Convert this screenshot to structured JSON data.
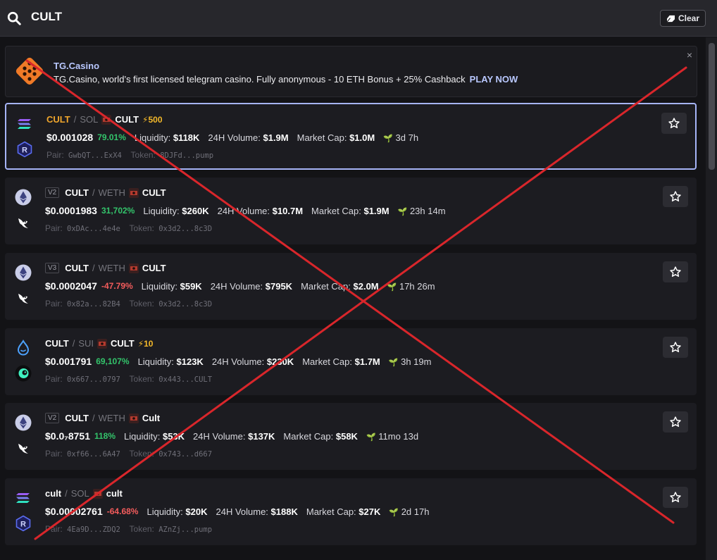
{
  "search": {
    "value": "CULT",
    "clear_label": "Clear"
  },
  "ad": {
    "title": "TG.Casino",
    "text": "TG.Casino, world’s first licensed telegram casino. Fully anonymous - 10 ETH Bonus + 25% Cashback",
    "cta": "PLAY NOW",
    "close": "×"
  },
  "results": [
    {
      "chain": "solana",
      "dex": "raydium",
      "version": "",
      "base": "CULT",
      "slash": "/",
      "quote": "SOL",
      "name": "CULT",
      "boost": "⚡500",
      "price": "$0.001028",
      "change": "79.01%",
      "liq_label": "Liquidity:",
      "liquidity": "$118K",
      "vol_label": "24H Volume:",
      "volume": "$1.9M",
      "mcap_label": "Market Cap:",
      "mcap": "$1.0M",
      "age": "3d 7h",
      "pair_label": "Pair:",
      "pair": "GwbQT...ExX4",
      "token_label": "Token:",
      "token": "8DJFd...pump"
    },
    {
      "chain": "ethereum",
      "dex": "uniswap",
      "version": "V2",
      "base": "CULT",
      "slash": "/",
      "quote": "WETH",
      "name": "CULT",
      "boost": "",
      "price": "$0.0001983",
      "change": "31,702%",
      "liq_label": "Liquidity:",
      "liquidity": "$260K",
      "vol_label": "24H Volume:",
      "volume": "$10.7M",
      "mcap_label": "Market Cap:",
      "mcap": "$1.9M",
      "age": "23h 14m",
      "pair_label": "Pair:",
      "pair": "0xDAc...4e4e",
      "token_label": "Token:",
      "token": "0x3d2...8c3D"
    },
    {
      "chain": "ethereum",
      "dex": "uniswap",
      "version": "V3",
      "base": "CULT",
      "slash": "/",
      "quote": "WETH",
      "name": "CULT",
      "boost": "",
      "price": "$0.0002047",
      "change": "-47.79%",
      "liq_label": "Liquidity:",
      "liquidity": "$59K",
      "vol_label": "24H Volume:",
      "volume": "$795K",
      "mcap_label": "Market Cap:",
      "mcap": "$2.0M",
      "age": "17h 26m",
      "pair_label": "Pair:",
      "pair": "0x82a...82B4",
      "token_label": "Token:",
      "token": "0x3d2...8c3D"
    },
    {
      "chain": "sui",
      "dex": "cetus",
      "version": "",
      "base": "CULT",
      "slash": "/",
      "quote": "SUI",
      "name": "CULT",
      "boost": "⚡10",
      "price": "$0.001791",
      "change": "69,107%",
      "liq_label": "Liquidity:",
      "liquidity": "$123K",
      "vol_label": "24H Volume:",
      "volume": "$230K",
      "mcap_label": "Market Cap:",
      "mcap": "$1.7M",
      "age": "3h 19m",
      "pair_label": "Pair:",
      "pair": "0x667...0797",
      "token_label": "Token:",
      "token": "0x443...CULT"
    },
    {
      "chain": "ethereum",
      "dex": "uniswap",
      "version": "V2",
      "base": "CULT",
      "slash": "/",
      "quote": "WETH",
      "name": "Cult",
      "boost": "",
      "price": "$0.0₇8751",
      "change": "118%",
      "liq_label": "Liquidity:",
      "liquidity": "$53K",
      "vol_label": "24H Volume:",
      "volume": "$137K",
      "mcap_label": "Market Cap:",
      "mcap": "$58K",
      "age": "11mo 13d",
      "pair_label": "Pair:",
      "pair": "0xf66...6A47",
      "token_label": "Token:",
      "token": "0x743...d667"
    },
    {
      "chain": "solana",
      "dex": "raydium",
      "version": "",
      "base": "cult",
      "slash": "/",
      "quote": "SOL",
      "name": "cult",
      "boost": "",
      "price": "$0.00002761",
      "change": "-64.68%",
      "liq_label": "Liquidity:",
      "liquidity": "$20K",
      "vol_label": "24H Volume:",
      "volume": "$188K",
      "mcap_label": "Market Cap:",
      "mcap": "$27K",
      "age": "2d 17h",
      "pair_label": "Pair:",
      "pair": "4Ea9D...ZDQ2",
      "token_label": "Token:",
      "token": "AZnZj...pump"
    }
  ],
  "colors": {
    "accent": "#b9c8ff",
    "selected_border": "#a6b4f7",
    "positive": "#33c46b",
    "negative": "#f45c5c",
    "boost": "#f4b92a",
    "overlay_cross": "#d9262b"
  }
}
